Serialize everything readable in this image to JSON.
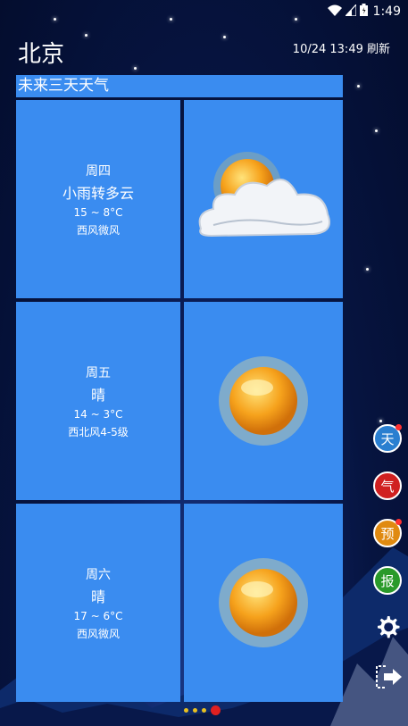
{
  "status": {
    "time": "1:49"
  },
  "header": {
    "city": "北京",
    "refresh_text": "10/24 13:49 刷新"
  },
  "section_title": "未来三天天气",
  "forecast": [
    {
      "day": "周四",
      "condition": "小雨转多云",
      "temp": "15 ~ 8°C",
      "wind": "西风微风",
      "icon": "sun-cloud-icon"
    },
    {
      "day": "周五",
      "condition": "晴",
      "temp": "14 ~ 3°C",
      "wind": "西北风4-5级",
      "icon": "sun-icon"
    },
    {
      "day": "周六",
      "condition": "晴",
      "temp": "17 ~ 6°C",
      "wind": "西风微风",
      "icon": "sun-icon"
    }
  ],
  "side_buttons": [
    {
      "label": "天",
      "color": "#2a7fd0",
      "badge": true
    },
    {
      "label": "气",
      "color": "#d02020",
      "badge": false
    },
    {
      "label": "预",
      "color": "#e08a10",
      "badge": true
    },
    {
      "label": "报",
      "color": "#2a9a2a",
      "badge": false
    }
  ],
  "pager": {
    "count": 4,
    "active_index": 3
  }
}
